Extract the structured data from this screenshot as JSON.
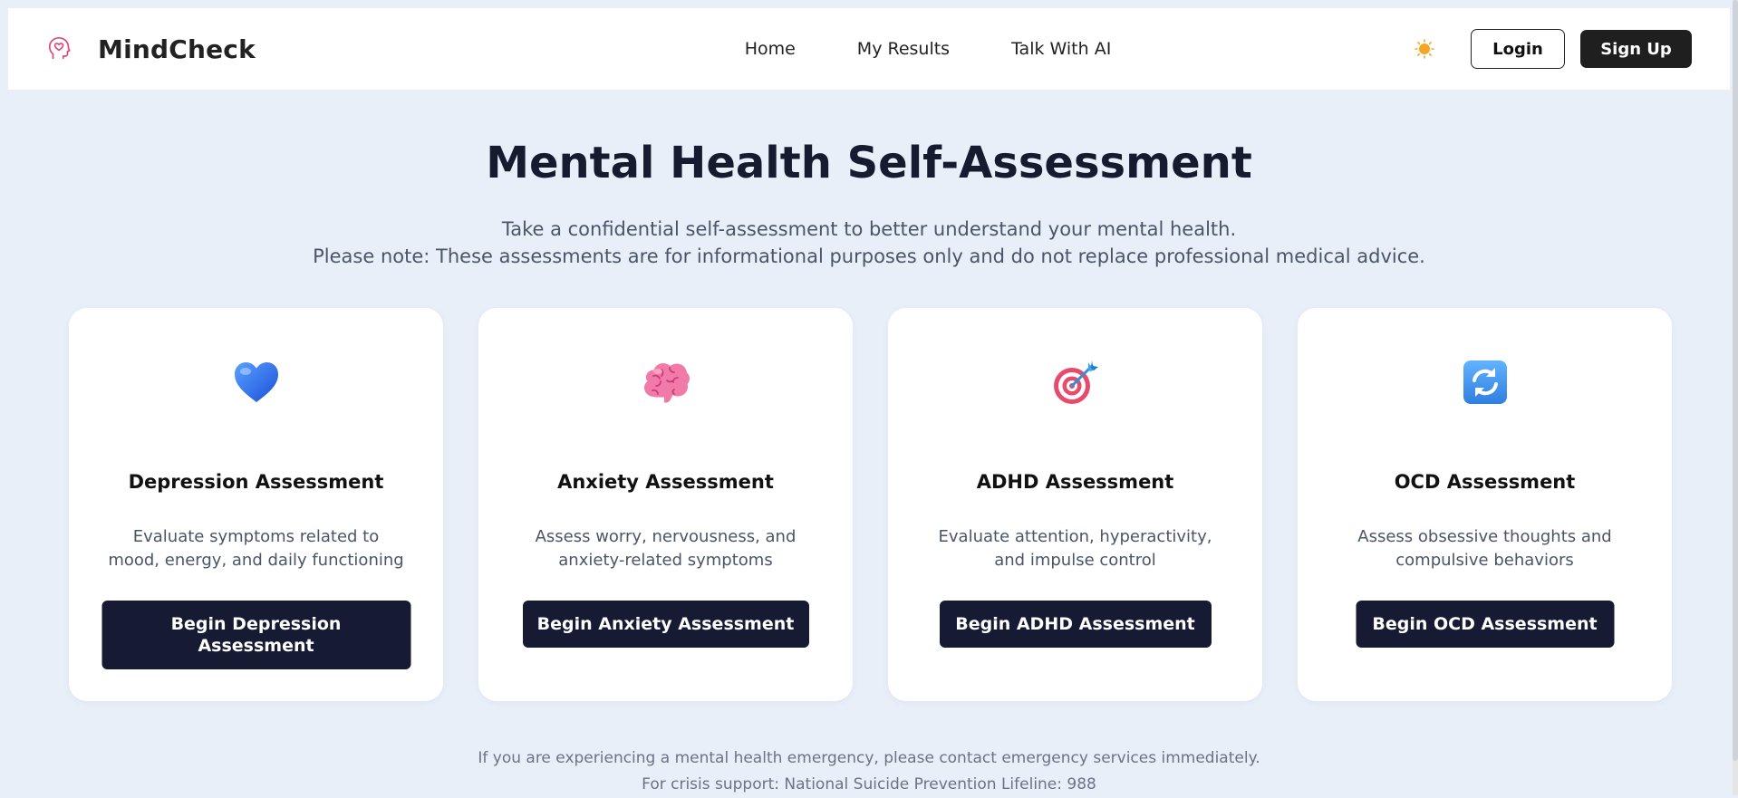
{
  "nav": {
    "brand": "MindCheck",
    "links": [
      "Home",
      "My Results",
      "Talk With AI"
    ],
    "login_label": "Login",
    "signup_label": "Sign Up"
  },
  "hero": {
    "title": "Mental Health Self-Assessment",
    "subtitle_line1": "Take a confidential self-assessment to better understand your mental health.",
    "subtitle_line2": "Please note: These assessments are for informational purposes only and do not replace professional medical advice."
  },
  "cards": [
    {
      "icon": "blue-heart-icon",
      "title": "Depression Assessment",
      "desc": "Evaluate symptoms related to mood, energy, and daily functioning",
      "button": "Begin Depression Assessment"
    },
    {
      "icon": "brain-icon",
      "title": "Anxiety Assessment",
      "desc": "Assess worry, nervousness, and anxiety-related symptoms",
      "button": "Begin Anxiety Assessment"
    },
    {
      "icon": "target-icon",
      "title": "ADHD Assessment",
      "desc": "Evaluate attention, hyperactivity, and impulse control",
      "button": "Begin ADHD Assessment"
    },
    {
      "icon": "repeat-arrows-icon",
      "title": "OCD Assessment",
      "desc": "Assess obsessive thoughts and compulsive behaviors",
      "button": "Begin OCD Assessment"
    }
  ],
  "footer": {
    "line1": "If you are experiencing a mental health emergency, please contact emergency services immediately.",
    "line2": "For crisis support: National Suicide Prevention Lifeline: 988"
  },
  "colors": {
    "page_bg": "#e8eff9",
    "accent_dark": "#161b33",
    "brand_icon": "#e0457b"
  }
}
